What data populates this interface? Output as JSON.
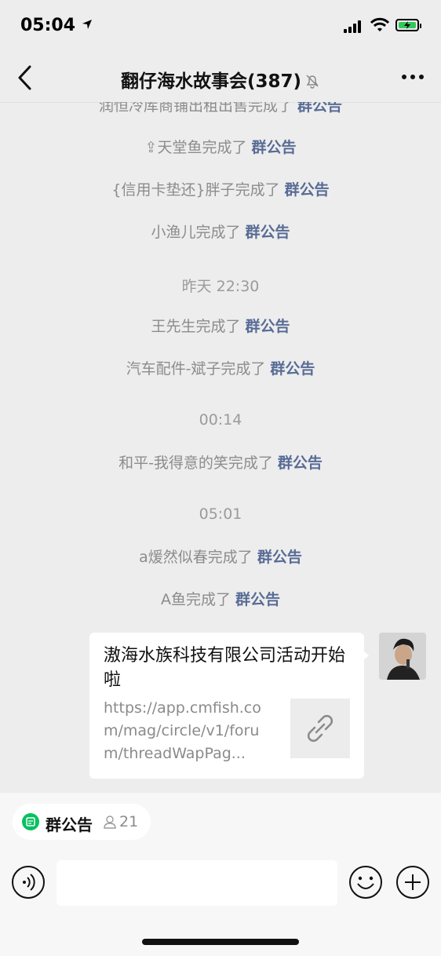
{
  "status_bar": {
    "time": "05:04"
  },
  "nav": {
    "title": "翻仔海水故事会(387)"
  },
  "messages": [
    {
      "name": "润恒冷库商铺出租出售完成了",
      "action": "群公告"
    },
    {
      "name": "⇪天堂鱼完成了",
      "action": "群公告"
    },
    {
      "name": "{信用卡垫还}胖子完成了",
      "action": "群公告"
    },
    {
      "name": "小渔儿完成了",
      "action": "群公告"
    },
    {
      "name": "王先生完成了",
      "action": "群公告"
    },
    {
      "name": "汽车配件-斌子完成了",
      "action": "群公告"
    },
    {
      "name": "和平-我得意的笑完成了",
      "action": "群公告"
    },
    {
      "name": "a煖然似春完成了",
      "action": "群公告"
    },
    {
      "name": "A鱼完成了",
      "action": "群公告"
    }
  ],
  "timestamps": [
    "昨天 22:30",
    "00:14",
    "05:01"
  ],
  "card": {
    "title": "滶海水族科技有限公司活动开始啦",
    "url": "https://app.cmfish.com/mag/circle/v1/forum/threadWapPag..."
  },
  "bottom": {
    "pill_label": "群公告",
    "pill_count": "21"
  },
  "colors": {
    "link": "#576b95",
    "accent_green": "#07c160",
    "background": "#ededed"
  }
}
